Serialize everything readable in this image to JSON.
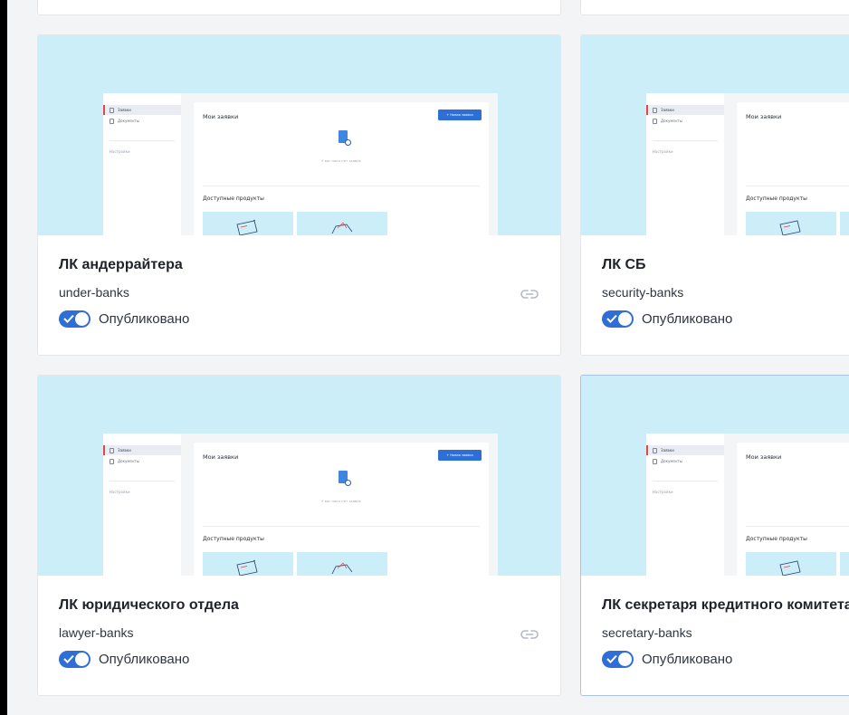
{
  "preview": {
    "side_items": [
      "Заявки",
      "Документы"
    ],
    "side_settings": "Настройки",
    "main_title": "Мои заявки",
    "new_button": "+  Новая заявка",
    "empty_text": "У вас пока нет заявок",
    "products_title": "Доступные продукты"
  },
  "cards": [
    {
      "title": "ЛК андеррайтера",
      "slug": "under-banks",
      "status": "Опубликовано"
    },
    {
      "title": "ЛК СБ",
      "slug": "security-banks",
      "status": "Опубликовано"
    },
    {
      "title": "ЛК юридического отдела",
      "slug": "lawyer-banks",
      "status": "Опубликовано"
    },
    {
      "title": "ЛК секретаря кредитного комитета",
      "slug": "secretary-banks",
      "status": "Опубликовано"
    }
  ],
  "colors": {
    "accent": "#2d6fd6",
    "preview_bg": "#cbeef9",
    "page_bg": "#f3f4f6"
  }
}
